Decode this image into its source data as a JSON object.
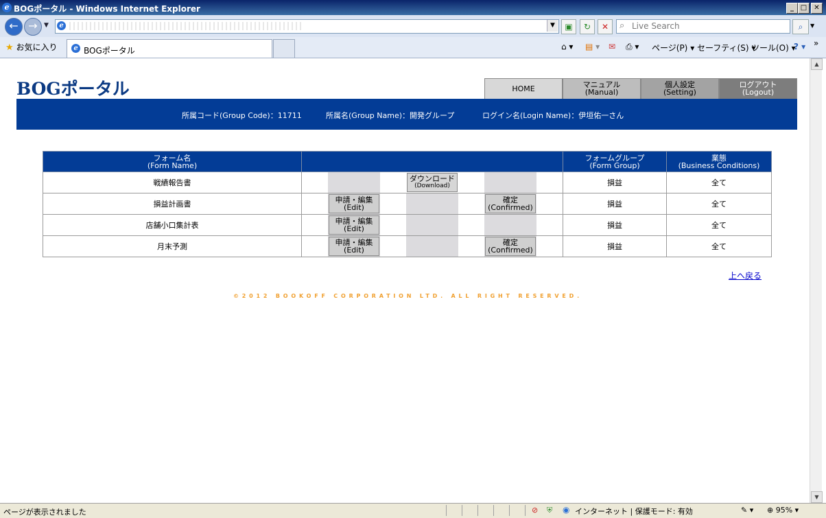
{
  "window": {
    "title": "BOGポータル - Windows Internet Explorer"
  },
  "browser": {
    "search_placeholder": "Live Search",
    "favorites_label": "お気に入り",
    "tab_title": "BOGポータル",
    "commands": {
      "page": "ページ(P)",
      "safety": "セーフティ(S)",
      "tools": "ツール(O)"
    },
    "status_text": "ページが表示されました",
    "zone_text": "インターネット | 保護モード: 有効",
    "zoom": "95%"
  },
  "page": {
    "logo": "BOGポータル",
    "nav": [
      {
        "l1": "HOME",
        "l2": ""
      },
      {
        "l1": "マニュアル",
        "l2": "(Manual)"
      },
      {
        "l1": "個人設定",
        "l2": "(Setting)"
      },
      {
        "l1": "ログアウト",
        "l2": "(Logout)"
      }
    ],
    "user_info": {
      "group_code": "所属コード(Group Code)：11711",
      "group_name": "所属名(Group Name)：開発グループ",
      "login_name": "ログイン名(Login Name)：伊垣佑一さん"
    },
    "table": {
      "headers": {
        "form_name": {
          "l1": "フォーム名",
          "l2": "(Form Name)"
        },
        "form_group": {
          "l1": "フォームグループ",
          "l2": "(Form Group)"
        },
        "business": {
          "l1": "業態",
          "l2": "(Business Conditions)"
        }
      },
      "buttons": {
        "edit": {
          "l1": "申請・編集",
          "l2": "(Edit)"
        },
        "download": {
          "l1": "ダウンロード",
          "l2": "(Download)"
        },
        "confirm": {
          "l1": "確定",
          "l2": "(Confirmed)"
        }
      },
      "rows": [
        {
          "name": "戦績報告書",
          "group": "損益",
          "business": "全て"
        },
        {
          "name": "損益計画書",
          "group": "損益",
          "business": "全て"
        },
        {
          "name": "店舗小口集計表",
          "group": "損益",
          "business": "全て"
        },
        {
          "name": "月末予測",
          "group": "損益",
          "business": "全て"
        }
      ]
    },
    "back_to_top": "上へ戻る",
    "copyright": "©2012 BOOKOFF CORPORATION LTD. ALL RIGHT RESERVED."
  }
}
